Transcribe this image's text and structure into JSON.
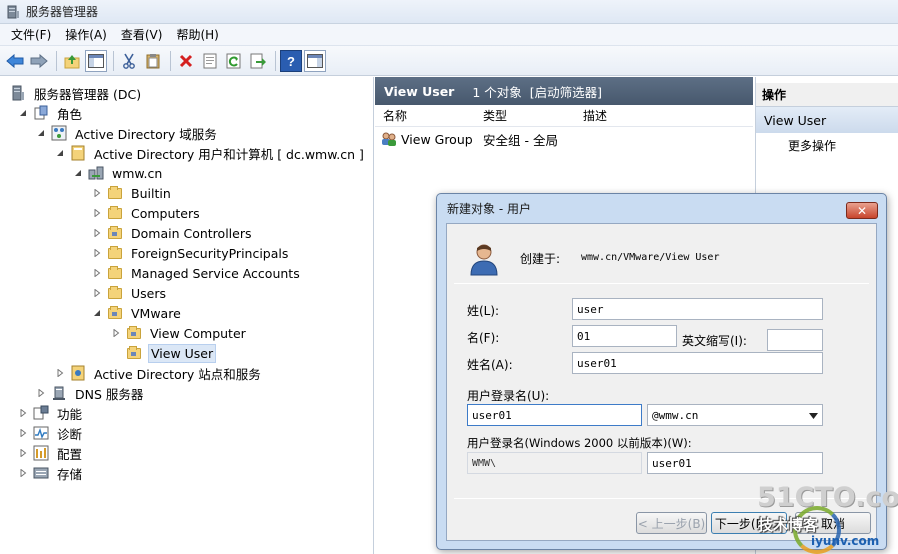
{
  "window": {
    "title": "服务器管理器"
  },
  "menu": [
    "文件(F)",
    "操作(A)",
    "查看(V)",
    "帮助(H)"
  ],
  "toolbar": {
    "icons": [
      "back-icon",
      "forward-icon",
      "up-folder-icon",
      "show-tree-icon",
      "cut-icon",
      "paste-icon",
      "delete-icon",
      "properties-icon",
      "refresh-icon",
      "export-icon",
      "help-icon",
      "action-pane-icon"
    ]
  },
  "tree": {
    "root": "服务器管理器 (DC)",
    "roles": "角色",
    "ad_ds": "Active Directory 域服务",
    "aduc": "Active Directory 用户和计算机 [ dc.wmw.cn ]",
    "domain": "wmw.cn",
    "builtin": "Builtin",
    "computers": "Computers",
    "domain_controllers": "Domain Controllers",
    "fsp": "ForeignSecurityPrincipals",
    "msa": "Managed Service Accounts",
    "users": "Users",
    "vmware": "VMware",
    "view_computer": "View Computer",
    "view_user": "View User",
    "ad_sites": "Active Directory 站点和服务",
    "dns": "DNS 服务器",
    "features": "功能",
    "diagnostics": "诊断",
    "configuration": "配置",
    "storage": "存储"
  },
  "list": {
    "header_title": "View User",
    "header_count": "1 个对象",
    "header_filter": "[启动筛选器]",
    "columns": [
      "名称",
      "类型",
      "描述"
    ],
    "rows": [
      {
        "name": "View Group",
        "type": "安全组 - 全局",
        "desc": ""
      }
    ]
  },
  "actions": {
    "title": "操作",
    "section": "View User",
    "more": "更多操作"
  },
  "dialog": {
    "title": "新建对象 - 用户",
    "close": "✕",
    "created_in_label": "创建于:",
    "created_in_value": "wmw.cn/VMware/View User",
    "last_name_label": "姓(L):",
    "last_name_value": "user",
    "first_name_label": "名(F):",
    "first_name_value": "01",
    "initials_label": "英文缩写(I):",
    "initials_value": "",
    "full_name_label": "姓名(A):",
    "full_name_value": "user01",
    "logon_label": "用户登录名(U):",
    "logon_value": "user01",
    "domain_suffix": "@wmw.cn",
    "pre2000_label": "用户登录名(Windows 2000 以前版本)(W):",
    "pre2000_domain": "WMW\\",
    "pre2000_value": "user01",
    "back_button": "< 上一步(B)",
    "next_button": "下一步(N) >",
    "cancel_button": "取消"
  },
  "watermark": {
    "logo": "51CTO.com",
    "sub": "技术博客",
    "url": "iyunv.com"
  }
}
